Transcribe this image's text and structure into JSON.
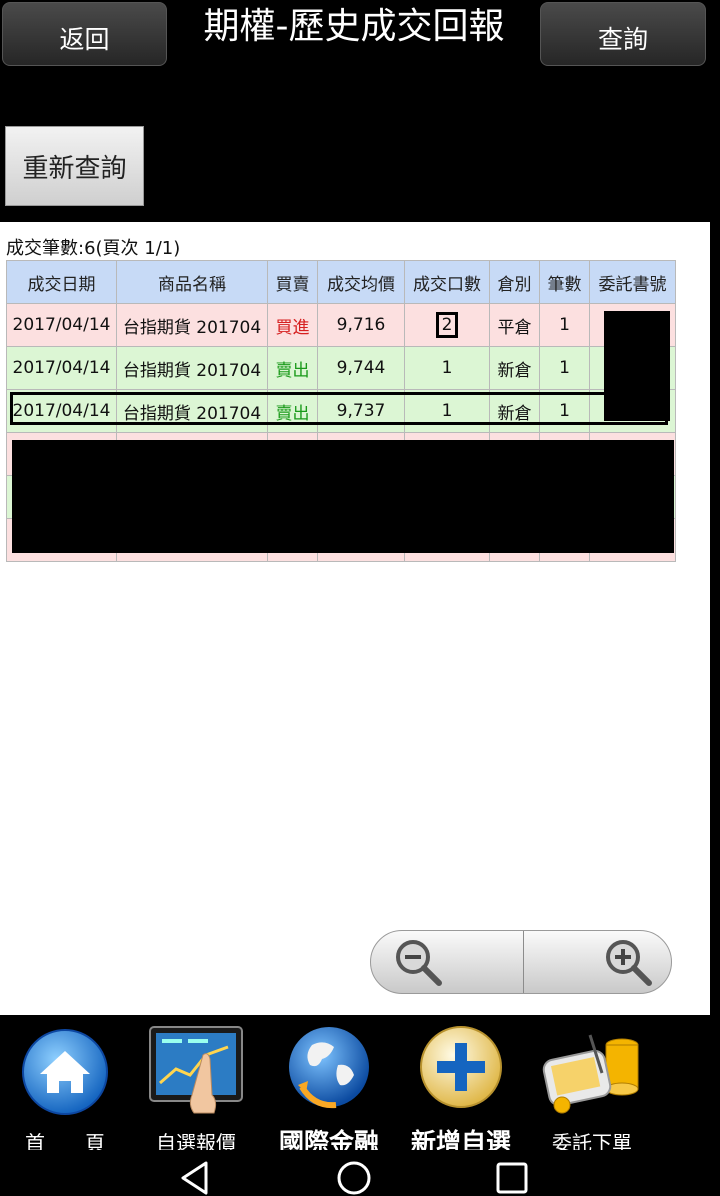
{
  "header": {
    "back_label": "返回",
    "title": "期權-歷史成交回報",
    "query_label": "查詢"
  },
  "requery_label": "重新查詢",
  "summary": "成交筆數:6(頁次 1/1)",
  "table": {
    "columns": [
      "成交日期",
      "商品名稱",
      "買賣",
      "成交均價",
      "成交口數",
      "倉別",
      "筆數",
      "委託書號"
    ],
    "rows": [
      {
        "date": "2017/04/14",
        "product": "台指期貨 201704",
        "side": "買進",
        "price": "9,716",
        "qty": "2",
        "position": "平倉",
        "count": "1"
      },
      {
        "date": "2017/04/14",
        "product": "台指期貨 201704",
        "side": "賣出",
        "price": "9,744",
        "qty": "1",
        "position": "新倉",
        "count": "1"
      },
      {
        "date": "2017/04/14",
        "product": "台指期貨 201704",
        "side": "賣出",
        "price": "9,737",
        "qty": "1",
        "position": "新倉",
        "count": "1"
      }
    ]
  },
  "bottom_nav": [
    {
      "label": "首　　頁",
      "icon": "home-icon"
    },
    {
      "label": "自選報價",
      "icon": "watchlist-quote-icon"
    },
    {
      "label": "國際金融",
      "icon": "globe-icon"
    },
    {
      "label": "新增自選",
      "icon": "add-icon"
    },
    {
      "label": "委託下單",
      "icon": "order-icon"
    }
  ],
  "colors": {
    "buy": "#d62020",
    "sell": "#1a9a1a",
    "header_bg": "#c7daf6",
    "buy_row": "#fce0e0",
    "sell_row": "#dcf6d4"
  }
}
